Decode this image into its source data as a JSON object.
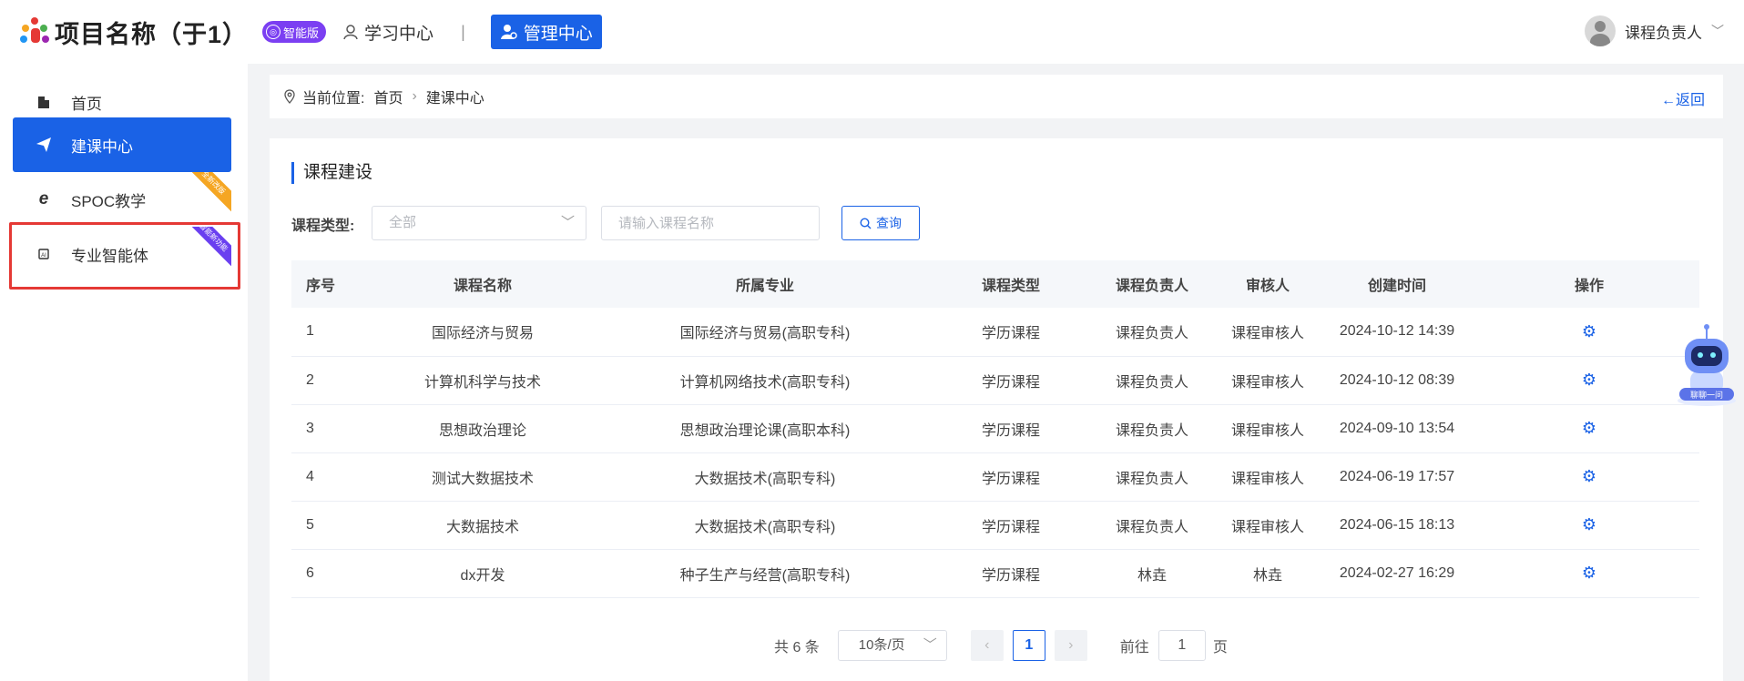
{
  "header": {
    "project_title": "项目名称（于1）",
    "ai_badge": "智能版",
    "learn_center": "学习中心",
    "separator": "|",
    "manage_center": "管理中心",
    "user_name": "课程负责人"
  },
  "sidebar": {
    "items": [
      {
        "label": "首页",
        "icon": "building-icon"
      },
      {
        "label": "建课中心",
        "icon": "paper-plane-icon",
        "active": true,
        "ribbon": "全新改版"
      },
      {
        "label": "SPOC教学",
        "icon": "ie-icon"
      },
      {
        "label": "专业智能体",
        "icon": "ai-chip-icon",
        "ribbon": "智能新功能"
      }
    ]
  },
  "breadcrumb": {
    "prefix": "当前位置:",
    "home": "首页",
    "current": "建课中心",
    "back": "←返回"
  },
  "main": {
    "section_title": "课程建设",
    "filter_label": "课程类型:",
    "select_value": "全部",
    "search_placeholder": "请输入课程名称",
    "query_button": "查询"
  },
  "table": {
    "headers": [
      "序号",
      "课程名称",
      "所属专业",
      "课程类型",
      "课程负责人",
      "审核人",
      "创建时间",
      "操作"
    ],
    "rows": [
      [
        "1",
        "国际经济与贸易",
        "国际经济与贸易(高职专科)",
        "学历课程",
        "课程负责人",
        "课程审核人",
        "2024-10-12 14:39"
      ],
      [
        "2",
        "计算机科学与技术",
        "计算机网络技术(高职专科)",
        "学历课程",
        "课程负责人",
        "课程审核人",
        "2024-10-12 08:39"
      ],
      [
        "3",
        "思想政治理论",
        "思想政治理论课(高职本科)",
        "学历课程",
        "课程负责人",
        "课程审核人",
        "2024-09-10 13:54"
      ],
      [
        "4",
        "测试大数据技术",
        "大数据技术(高职专科)",
        "学历课程",
        "课程负责人",
        "课程审核人",
        "2024-06-19 17:57"
      ],
      [
        "5",
        "大数据技术",
        "大数据技术(高职专科)",
        "学历课程",
        "课程负责人",
        "课程审核人",
        "2024-06-15 18:13"
      ],
      [
        "6",
        "dx开发",
        "种子生产与经营(高职专科)",
        "学历课程",
        "林垚",
        "林垚",
        "2024-02-27 16:29"
      ]
    ]
  },
  "pagination": {
    "total": "共 6 条",
    "page_size": "10条/页",
    "current_page": "1",
    "goto_prefix": "前往",
    "goto_value": "1",
    "goto_suffix": "页"
  },
  "assistant": {
    "label": "聊聊一问"
  },
  "colors": {
    "accent": "#1a62e6",
    "ai_badge": "#7b3ff2",
    "highlight": "#e53935"
  }
}
